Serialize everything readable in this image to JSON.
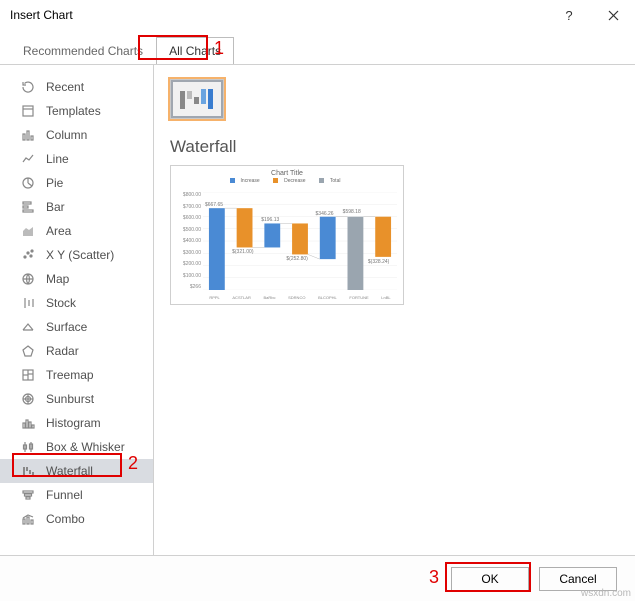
{
  "title": "Insert Chart",
  "tabs": {
    "recommended": "Recommended Charts",
    "all": "All Charts"
  },
  "sidebar": {
    "items": [
      {
        "label": "Recent"
      },
      {
        "label": "Templates"
      },
      {
        "label": "Column"
      },
      {
        "label": "Line"
      },
      {
        "label": "Pie"
      },
      {
        "label": "Bar"
      },
      {
        "label": "Area"
      },
      {
        "label": "X Y (Scatter)"
      },
      {
        "label": "Map"
      },
      {
        "label": "Stock"
      },
      {
        "label": "Surface"
      },
      {
        "label": "Radar"
      },
      {
        "label": "Treemap"
      },
      {
        "label": "Sunburst"
      },
      {
        "label": "Histogram"
      },
      {
        "label": "Box & Whisker"
      },
      {
        "label": "Waterfall"
      },
      {
        "label": "Funnel"
      },
      {
        "label": "Combo"
      }
    ]
  },
  "content": {
    "chart_type_name": "Waterfall",
    "preview_title": "Chart Title"
  },
  "legend": {
    "inc": "Increase",
    "dec": "Decrease",
    "tot": "Total"
  },
  "yaxis": [
    "$800.00",
    "$700.00",
    "$600.00",
    "$500.00",
    "$400.00",
    "$300.00",
    "$200.00",
    "$100.00",
    "$266"
  ],
  "xaxis": [
    "RPPL",
    "ACSTLAR",
    "BaRbc",
    "SDRNCO",
    "BLCOPHL",
    "FORTUNE",
    "LnBL"
  ],
  "datalabels": [
    "$667.65",
    "$(321.00)",
    "$196.13",
    "$(252.80)",
    "$346.26",
    "$598.18",
    "$(328.24)"
  ],
  "footer": {
    "ok": "OK",
    "cancel": "Cancel"
  },
  "callouts": {
    "n1": "1",
    "n2": "2",
    "n3": "3"
  },
  "watermark": "wsxdn.com",
  "chart_data": {
    "type": "bar",
    "title": "Chart Title",
    "legend": [
      "Increase",
      "Decrease",
      "Total"
    ],
    "categories": [
      "RPPL",
      "ACSTLAR",
      "BaRbc",
      "SDRNCO",
      "BLCOPHL",
      "FORTUNE",
      "LnBL"
    ],
    "series": [
      {
        "name": "waterfall",
        "values": [
          667.65,
          -321.0,
          196.13,
          -252.8,
          346.26,
          598.18,
          -328.24
        ],
        "kind": [
          "inc",
          "dec",
          "inc",
          "dec",
          "inc",
          "total",
          "dec"
        ]
      }
    ],
    "ylabel": "",
    "xlabel": "",
    "ylim": [
      0,
      800
    ]
  }
}
